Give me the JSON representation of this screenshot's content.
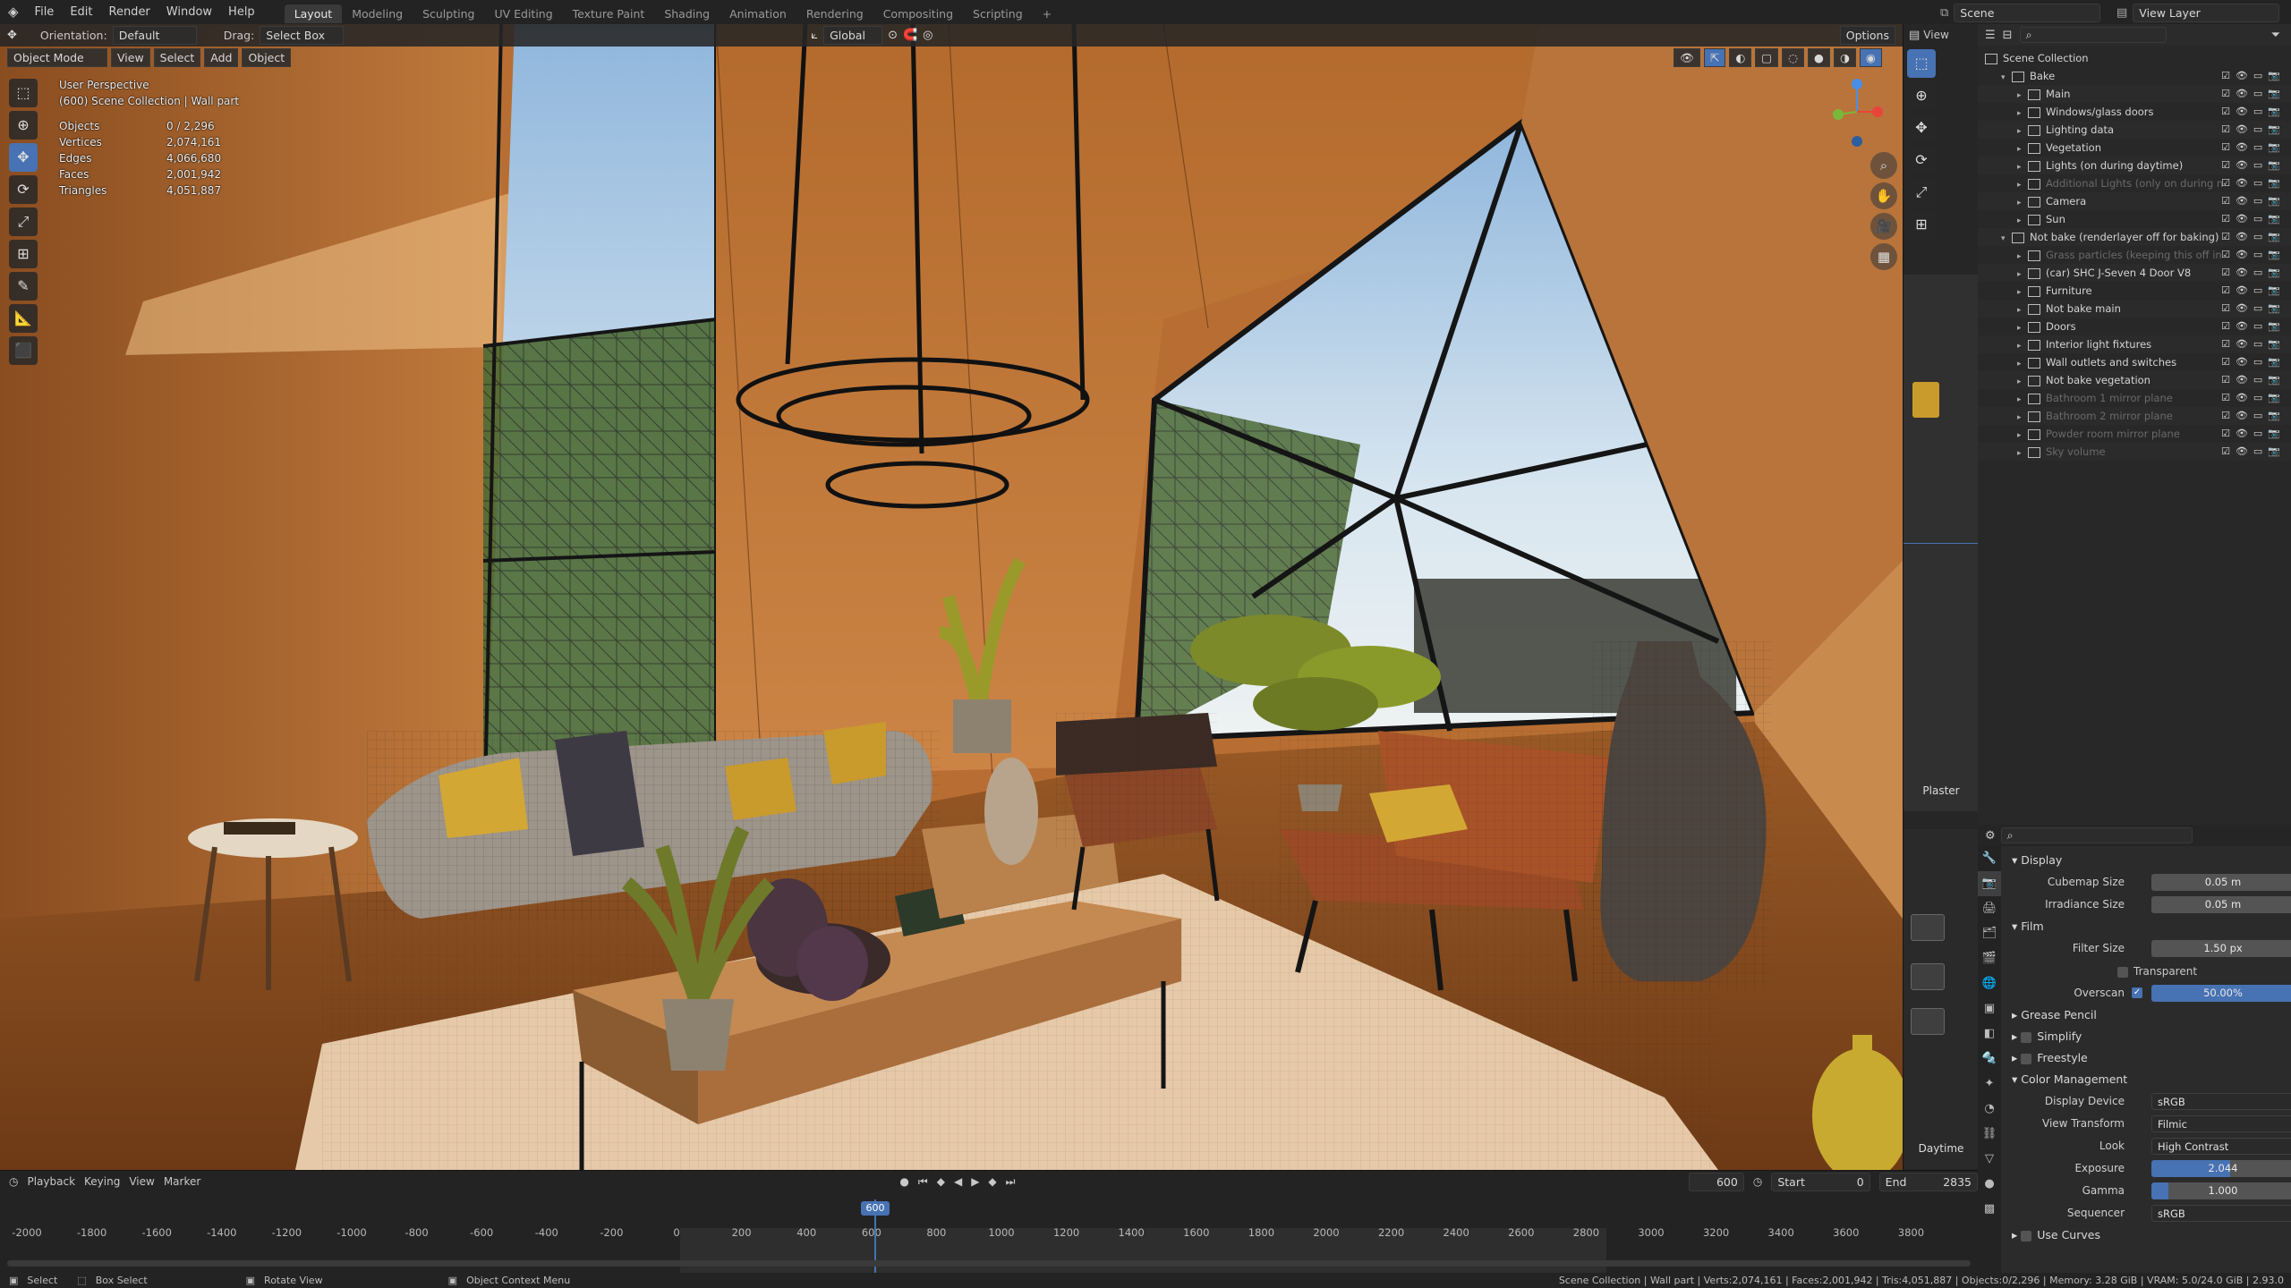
{
  "menubar": {
    "items": [
      "File",
      "Edit",
      "Render",
      "Window",
      "Help"
    ],
    "workspaces": [
      "Layout",
      "Modeling",
      "Sculpting",
      "UV Editing",
      "Texture Paint",
      "Shading",
      "Animation",
      "Rendering",
      "Compositing",
      "Scripting"
    ],
    "active_workspace": "Layout",
    "scene": "Scene",
    "view_layer": "View Layer"
  },
  "tool_header": {
    "orientation_label": "Orientation:",
    "orientation_value": "Default",
    "drag_label": "Drag:",
    "drag_value": "Select Box",
    "transform_orientation": "Global",
    "options": "Options"
  },
  "viewport_header": {
    "mode": "Object Mode",
    "menus": [
      "View",
      "Select",
      "Add",
      "Object"
    ]
  },
  "viewport_overlay": {
    "title": "User Perspective",
    "subtitle": "(600) Scene Collection | Wall part",
    "stats": [
      {
        "label": "Objects",
        "value": "0 / 2,296"
      },
      {
        "label": "Vertices",
        "value": "2,074,161"
      },
      {
        "label": "Edges",
        "value": "4,066,680"
      },
      {
        "label": "Faces",
        "value": "2,001,942"
      },
      {
        "label": "Triangles",
        "value": "4,051,887"
      }
    ]
  },
  "outliner": {
    "root": "Scene Collection",
    "rows": [
      {
        "label": "Bake",
        "depth": 1,
        "dim": false
      },
      {
        "label": "Main",
        "depth": 2,
        "dim": false
      },
      {
        "label": "Windows/glass doors",
        "depth": 2,
        "dim": false
      },
      {
        "label": "Lighting data",
        "depth": 2,
        "dim": false
      },
      {
        "label": "Vegetation",
        "depth": 2,
        "dim": false
      },
      {
        "label": "Lights (on during daytime)",
        "depth": 2,
        "dim": false
      },
      {
        "label": "Additional Lights (only on during n",
        "depth": 2,
        "dim": true
      },
      {
        "label": "Camera",
        "depth": 2,
        "dim": false
      },
      {
        "label": "Sun",
        "depth": 2,
        "dim": false
      },
      {
        "label": "Not bake (renderlayer off for baking)",
        "depth": 1,
        "dim": false
      },
      {
        "label": "Grass particles (keeping this off in",
        "depth": 2,
        "dim": true
      },
      {
        "label": "(car) SHC J-Seven 4 Door V8",
        "depth": 2,
        "dim": false
      },
      {
        "label": "Furniture",
        "depth": 2,
        "dim": false
      },
      {
        "label": "Not bake main",
        "depth": 2,
        "dim": false
      },
      {
        "label": "Doors",
        "depth": 2,
        "dim": false
      },
      {
        "label": "Interior light fixtures",
        "depth": 2,
        "dim": false
      },
      {
        "label": "Wall outlets and switches",
        "depth": 2,
        "dim": false
      },
      {
        "label": "Not bake vegetation",
        "depth": 2,
        "dim": false
      },
      {
        "label": "Bathroom 1 mirror plane",
        "depth": 2,
        "dim": true
      },
      {
        "label": "Bathroom 2 mirror plane",
        "depth": 2,
        "dim": true
      },
      {
        "label": "Powder room mirror plane",
        "depth": 2,
        "dim": true
      },
      {
        "label": "Sky volume",
        "depth": 2,
        "dim": true
      }
    ]
  },
  "side_panels": {
    "material_label": "Plaster",
    "world_label": "Daytime",
    "mini_header": "View"
  },
  "properties": {
    "display_section": "Display",
    "cubemap_size_label": "Cubemap Size",
    "cubemap_size": "0.05 m",
    "irradiance_size_label": "Irradiance Size",
    "irradiance_size": "0.05 m",
    "film_section": "Film",
    "filter_size_label": "Filter Size",
    "filter_size": "1.50 px",
    "transparent_label": "Transparent",
    "overscan_label": "Overscan",
    "overscan": "50.00%",
    "grease_pencil": "Grease Pencil",
    "simplify": "Simplify",
    "freestyle": "Freestyle",
    "color_mgmt": "Color Management",
    "display_device_label": "Display Device",
    "display_device": "sRGB",
    "view_transform_label": "View Transform",
    "view_transform": "Filmic",
    "look_label": "Look",
    "look": "High Contrast",
    "exposure_label": "Exposure",
    "exposure": "2.044",
    "gamma_label": "Gamma",
    "gamma": "1.000",
    "sequencer_label": "Sequencer",
    "sequencer": "sRGB",
    "use_curves": "Use Curves"
  },
  "timeline": {
    "menus": [
      "Playback",
      "Keying",
      "View",
      "Marker"
    ],
    "current_frame": "600",
    "start_label": "Start",
    "start": "0",
    "end_label": "End",
    "end": "2835",
    "ruler": [
      "-2000",
      "-1800",
      "-1600",
      "-1400",
      "-1200",
      "-1000",
      "-800",
      "-600",
      "-400",
      "-200",
      "0",
      "200",
      "400",
      "600",
      "800",
      "1000",
      "1200",
      "1400",
      "1600",
      "1800",
      "2000",
      "2200",
      "2400",
      "2600",
      "2800",
      "3000",
      "3200",
      "3400",
      "3600",
      "3800"
    ]
  },
  "statusbar": {
    "select": "Select",
    "box_select": "Box Select",
    "rotate_view": "Rotate View",
    "context_menu": "Object Context Menu",
    "info": "Scene Collection | Wall part | Verts:2,074,161 | Faces:2,001,942 | Tris:4,051,887 | Objects:0/2,296 | Memory: 3.28 GiB | VRAM: 5.0/24.0 GiB | 2.93.0"
  },
  "colors": {
    "accent": "#4772b3",
    "wood": "#b86e32",
    "sky": "#bcd6ea"
  }
}
